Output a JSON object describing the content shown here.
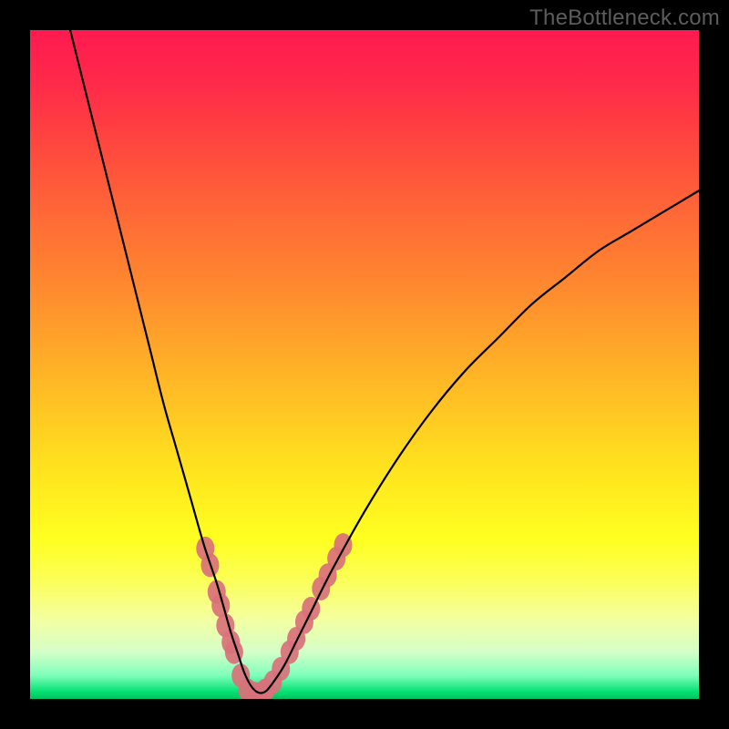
{
  "watermark": "TheBottleneck.com",
  "chart_data": {
    "type": "line",
    "title": "",
    "xlabel": "",
    "ylabel": "",
    "xlim": [
      0,
      100
    ],
    "ylim": [
      0,
      100
    ],
    "curve": {
      "name": "bottleneck-curve",
      "x": [
        6,
        8,
        10,
        12,
        14,
        16,
        18,
        20,
        22,
        24,
        26,
        28,
        30,
        31,
        32,
        33,
        34,
        35,
        36,
        38,
        40,
        42,
        45,
        50,
        55,
        60,
        65,
        70,
        75,
        80,
        85,
        90,
        95,
        100
      ],
      "y": [
        100,
        92,
        84,
        76,
        68,
        60,
        52,
        44,
        37,
        30,
        23,
        17,
        10,
        7,
        4,
        2,
        1,
        1,
        2,
        5,
        9,
        13,
        19,
        28,
        36,
        43,
        49,
        54,
        59,
        63,
        67,
        70,
        73,
        76
      ]
    },
    "markers": {
      "name": "highlight-dots",
      "color": "#d9717a",
      "points": [
        {
          "x": 26.2,
          "y": 22.5
        },
        {
          "x": 26.9,
          "y": 20.0
        },
        {
          "x": 27.9,
          "y": 16.0
        },
        {
          "x": 28.5,
          "y": 14.0
        },
        {
          "x": 29.2,
          "y": 11.0
        },
        {
          "x": 30.0,
          "y": 8.5
        },
        {
          "x": 30.5,
          "y": 7.0
        },
        {
          "x": 31.5,
          "y": 3.5
        },
        {
          "x": 32.5,
          "y": 1.3
        },
        {
          "x": 33.5,
          "y": 0.8
        },
        {
          "x": 34.5,
          "y": 0.8
        },
        {
          "x": 35.2,
          "y": 1.3
        },
        {
          "x": 36.3,
          "y": 2.5
        },
        {
          "x": 37.5,
          "y": 4.5
        },
        {
          "x": 38.8,
          "y": 7.0
        },
        {
          "x": 39.8,
          "y": 9.0
        },
        {
          "x": 41.0,
          "y": 11.5
        },
        {
          "x": 42.0,
          "y": 13.5
        },
        {
          "x": 43.5,
          "y": 16.5
        },
        {
          "x": 44.5,
          "y": 18.5
        },
        {
          "x": 45.8,
          "y": 21.0
        },
        {
          "x": 46.8,
          "y": 23.0
        }
      ]
    }
  }
}
